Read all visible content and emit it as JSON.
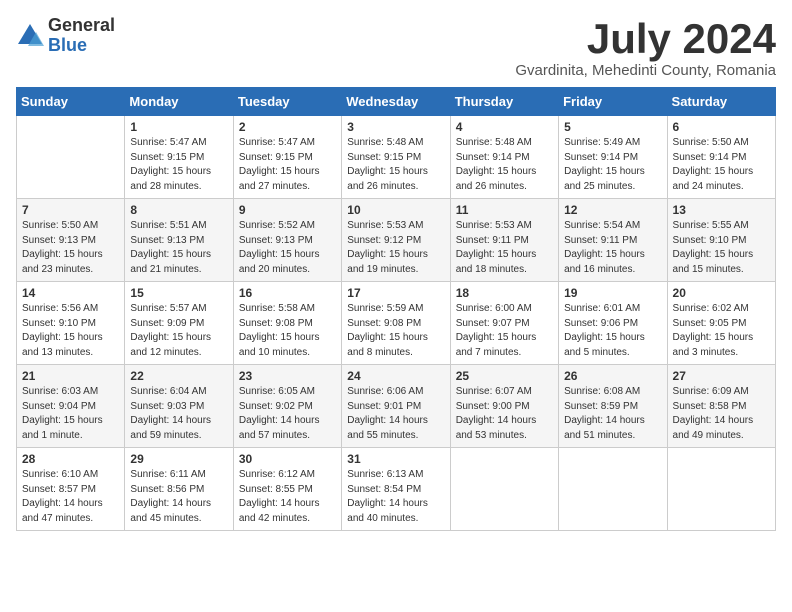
{
  "logo": {
    "general": "General",
    "blue": "Blue"
  },
  "title": "July 2024",
  "location": "Gvardinita, Mehedinti County, Romania",
  "days_of_week": [
    "Sunday",
    "Monday",
    "Tuesday",
    "Wednesday",
    "Thursday",
    "Friday",
    "Saturday"
  ],
  "weeks": [
    [
      {
        "day": "",
        "info": ""
      },
      {
        "day": "1",
        "info": "Sunrise: 5:47 AM\nSunset: 9:15 PM\nDaylight: 15 hours\nand 28 minutes."
      },
      {
        "day": "2",
        "info": "Sunrise: 5:47 AM\nSunset: 9:15 PM\nDaylight: 15 hours\nand 27 minutes."
      },
      {
        "day": "3",
        "info": "Sunrise: 5:48 AM\nSunset: 9:15 PM\nDaylight: 15 hours\nand 26 minutes."
      },
      {
        "day": "4",
        "info": "Sunrise: 5:48 AM\nSunset: 9:14 PM\nDaylight: 15 hours\nand 26 minutes."
      },
      {
        "day": "5",
        "info": "Sunrise: 5:49 AM\nSunset: 9:14 PM\nDaylight: 15 hours\nand 25 minutes."
      },
      {
        "day": "6",
        "info": "Sunrise: 5:50 AM\nSunset: 9:14 PM\nDaylight: 15 hours\nand 24 minutes."
      }
    ],
    [
      {
        "day": "7",
        "info": "Sunrise: 5:50 AM\nSunset: 9:13 PM\nDaylight: 15 hours\nand 23 minutes."
      },
      {
        "day": "8",
        "info": "Sunrise: 5:51 AM\nSunset: 9:13 PM\nDaylight: 15 hours\nand 21 minutes."
      },
      {
        "day": "9",
        "info": "Sunrise: 5:52 AM\nSunset: 9:13 PM\nDaylight: 15 hours\nand 20 minutes."
      },
      {
        "day": "10",
        "info": "Sunrise: 5:53 AM\nSunset: 9:12 PM\nDaylight: 15 hours\nand 19 minutes."
      },
      {
        "day": "11",
        "info": "Sunrise: 5:53 AM\nSunset: 9:11 PM\nDaylight: 15 hours\nand 18 minutes."
      },
      {
        "day": "12",
        "info": "Sunrise: 5:54 AM\nSunset: 9:11 PM\nDaylight: 15 hours\nand 16 minutes."
      },
      {
        "day": "13",
        "info": "Sunrise: 5:55 AM\nSunset: 9:10 PM\nDaylight: 15 hours\nand 15 minutes."
      }
    ],
    [
      {
        "day": "14",
        "info": "Sunrise: 5:56 AM\nSunset: 9:10 PM\nDaylight: 15 hours\nand 13 minutes."
      },
      {
        "day": "15",
        "info": "Sunrise: 5:57 AM\nSunset: 9:09 PM\nDaylight: 15 hours\nand 12 minutes."
      },
      {
        "day": "16",
        "info": "Sunrise: 5:58 AM\nSunset: 9:08 PM\nDaylight: 15 hours\nand 10 minutes."
      },
      {
        "day": "17",
        "info": "Sunrise: 5:59 AM\nSunset: 9:08 PM\nDaylight: 15 hours\nand 8 minutes."
      },
      {
        "day": "18",
        "info": "Sunrise: 6:00 AM\nSunset: 9:07 PM\nDaylight: 15 hours\nand 7 minutes."
      },
      {
        "day": "19",
        "info": "Sunrise: 6:01 AM\nSunset: 9:06 PM\nDaylight: 15 hours\nand 5 minutes."
      },
      {
        "day": "20",
        "info": "Sunrise: 6:02 AM\nSunset: 9:05 PM\nDaylight: 15 hours\nand 3 minutes."
      }
    ],
    [
      {
        "day": "21",
        "info": "Sunrise: 6:03 AM\nSunset: 9:04 PM\nDaylight: 15 hours\nand 1 minute."
      },
      {
        "day": "22",
        "info": "Sunrise: 6:04 AM\nSunset: 9:03 PM\nDaylight: 14 hours\nand 59 minutes."
      },
      {
        "day": "23",
        "info": "Sunrise: 6:05 AM\nSunset: 9:02 PM\nDaylight: 14 hours\nand 57 minutes."
      },
      {
        "day": "24",
        "info": "Sunrise: 6:06 AM\nSunset: 9:01 PM\nDaylight: 14 hours\nand 55 minutes."
      },
      {
        "day": "25",
        "info": "Sunrise: 6:07 AM\nSunset: 9:00 PM\nDaylight: 14 hours\nand 53 minutes."
      },
      {
        "day": "26",
        "info": "Sunrise: 6:08 AM\nSunset: 8:59 PM\nDaylight: 14 hours\nand 51 minutes."
      },
      {
        "day": "27",
        "info": "Sunrise: 6:09 AM\nSunset: 8:58 PM\nDaylight: 14 hours\nand 49 minutes."
      }
    ],
    [
      {
        "day": "28",
        "info": "Sunrise: 6:10 AM\nSunset: 8:57 PM\nDaylight: 14 hours\nand 47 minutes."
      },
      {
        "day": "29",
        "info": "Sunrise: 6:11 AM\nSunset: 8:56 PM\nDaylight: 14 hours\nand 45 minutes."
      },
      {
        "day": "30",
        "info": "Sunrise: 6:12 AM\nSunset: 8:55 PM\nDaylight: 14 hours\nand 42 minutes."
      },
      {
        "day": "31",
        "info": "Sunrise: 6:13 AM\nSunset: 8:54 PM\nDaylight: 14 hours\nand 40 minutes."
      },
      {
        "day": "",
        "info": ""
      },
      {
        "day": "",
        "info": ""
      },
      {
        "day": "",
        "info": ""
      }
    ]
  ]
}
